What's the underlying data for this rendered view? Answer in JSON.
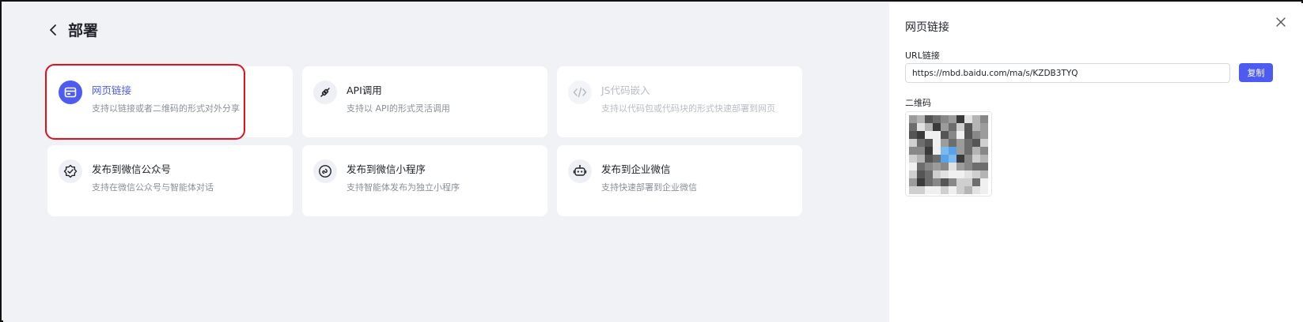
{
  "header": {
    "title": "部署",
    "back_icon": "chevron-left-icon"
  },
  "cards": [
    {
      "title": "网页链接",
      "desc": "支持以链接或者二维码的形式对外分享",
      "icon": "web-link-icon",
      "state": "selected"
    },
    {
      "title": "API调用",
      "desc": "支持以 API的形式灵活调用",
      "icon": "api-plug-icon",
      "state": "normal"
    },
    {
      "title": "JS代码嵌入",
      "desc": "支持以代码包或代码块的形式快速部署到网页",
      "icon": "code-icon",
      "state": "disabled"
    },
    {
      "title": "发布到微信公众号",
      "desc": "支持在微信公众号与智能体对话",
      "icon": "wechat-official-icon",
      "state": "normal"
    },
    {
      "title": "发布到微信小程序",
      "desc": "支持智能体发布为独立小程序",
      "icon": "mini-program-icon",
      "state": "normal"
    },
    {
      "title": "发布到企业微信",
      "desc": "支持快速部署到企业微信",
      "icon": "robot-icon",
      "state": "normal"
    }
  ],
  "panel": {
    "title": "网页链接",
    "url_label": "URL链接",
    "url_value": "https://mbd.baidu.com/ma/s/KZDB3TYQ",
    "copy_label": "复制",
    "qr_label": "二维码",
    "close_icon": "close-icon"
  },
  "colors": {
    "accent": "#4e5bf0",
    "highlight_border": "#e0101d",
    "background": "#f0f2f6"
  }
}
